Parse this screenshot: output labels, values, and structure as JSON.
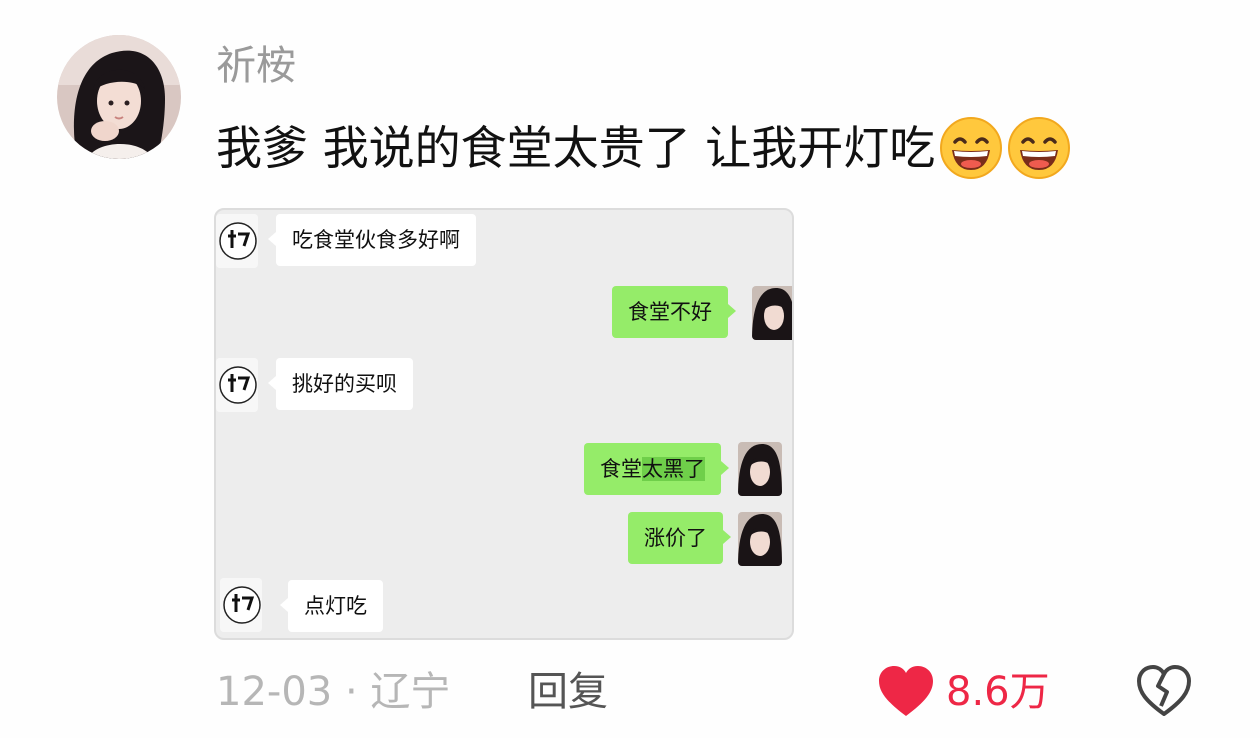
{
  "comment": {
    "username": "祈桉",
    "text": "我爹 我说的食堂太贵了 让我开灯吃",
    "emojis": [
      "grin-emoji",
      "grin-emoji"
    ]
  },
  "chat": {
    "messages": [
      {
        "side": "in",
        "text": "吃食堂伙食多好啊"
      },
      {
        "side": "out",
        "text": "食堂不好"
      },
      {
        "side": "in",
        "text": "挑好的买呗"
      },
      {
        "side": "out",
        "text_plain": "食堂",
        "text_highlight": "太黑了"
      },
      {
        "side": "out",
        "text": "涨价了"
      },
      {
        "side": "in",
        "text": "点灯吃"
      }
    ]
  },
  "footer": {
    "date": "12-03",
    "separator": "·",
    "location": "辽宁",
    "reply_label": "回复",
    "like_count": "8.6万",
    "like_color": "#ee2746"
  }
}
